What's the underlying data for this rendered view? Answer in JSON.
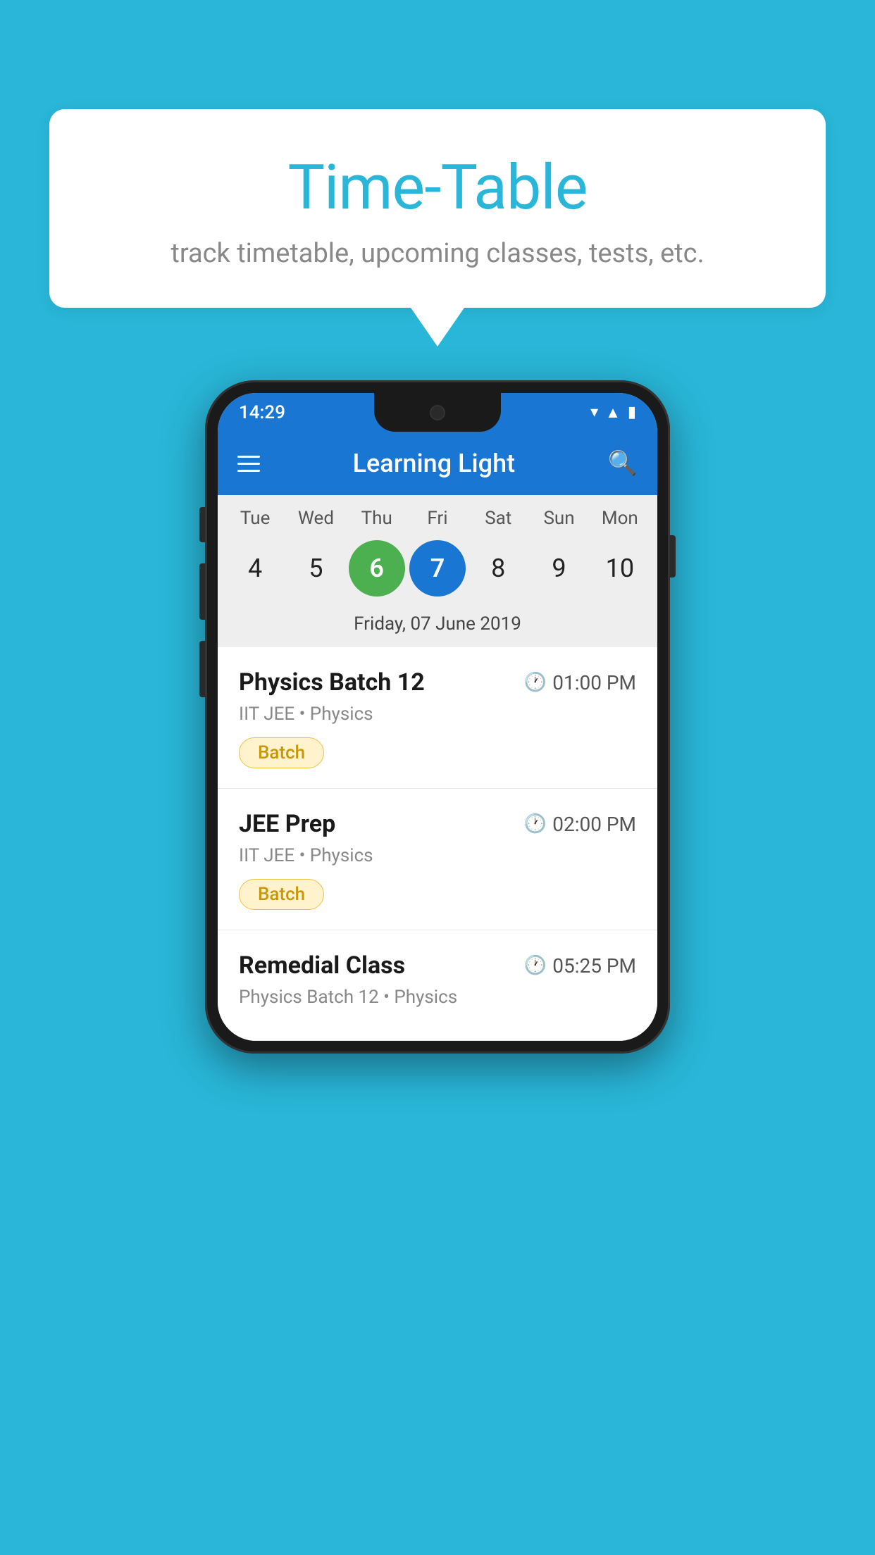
{
  "background_color": "#29b6d8",
  "speech_bubble": {
    "title": "Time-Table",
    "subtitle": "track timetable, upcoming classes, tests, etc."
  },
  "phone": {
    "status_bar": {
      "time": "14:29"
    },
    "app_bar": {
      "title": "Learning Light"
    },
    "calendar": {
      "days": [
        {
          "label": "Tue",
          "number": "4"
        },
        {
          "label": "Wed",
          "number": "5"
        },
        {
          "label": "Thu",
          "number": "6",
          "state": "today"
        },
        {
          "label": "Fri",
          "number": "7",
          "state": "selected"
        },
        {
          "label": "Sat",
          "number": "8"
        },
        {
          "label": "Sun",
          "number": "9"
        },
        {
          "label": "Mon",
          "number": "10"
        }
      ],
      "selected_date_label": "Friday, 07 June 2019"
    },
    "classes": [
      {
        "name": "Physics Batch 12",
        "time": "01:00 PM",
        "meta": "IIT JEE • Physics",
        "badge": "Batch"
      },
      {
        "name": "JEE Prep",
        "time": "02:00 PM",
        "meta": "IIT JEE • Physics",
        "badge": "Batch"
      },
      {
        "name": "Remedial Class",
        "time": "05:25 PM",
        "meta": "Physics Batch 12 • Physics",
        "badge": null
      }
    ]
  }
}
